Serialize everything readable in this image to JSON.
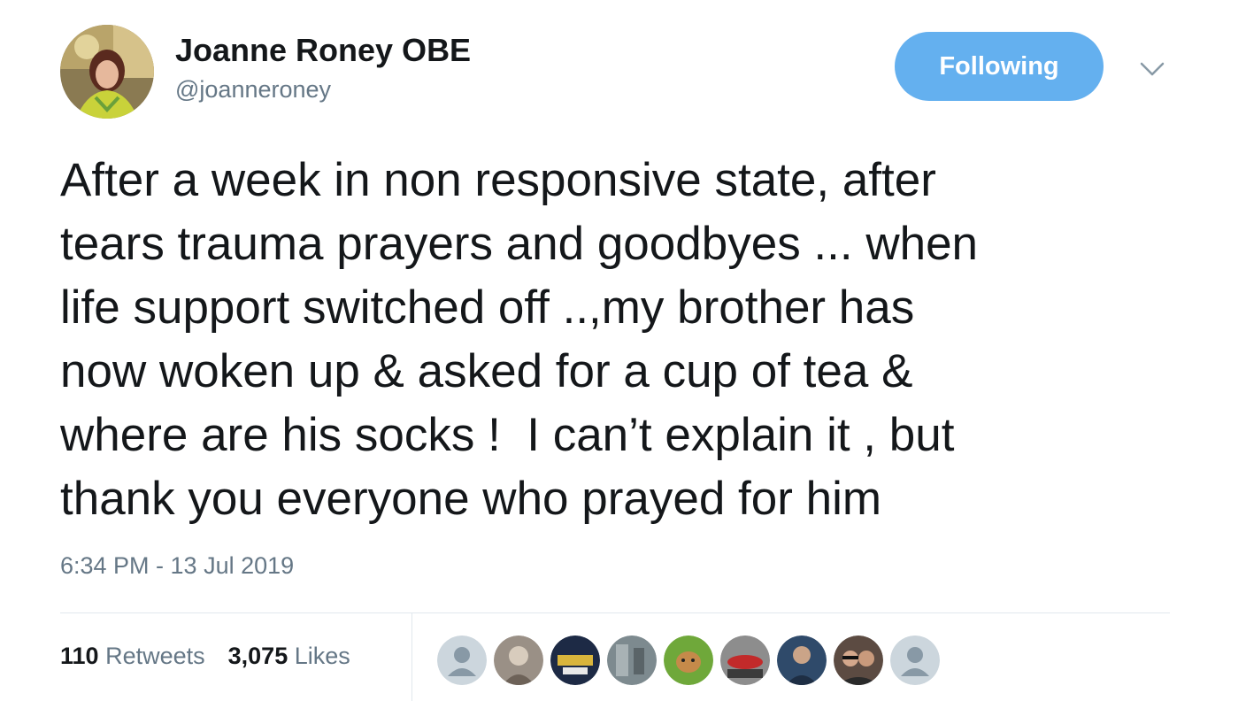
{
  "user": {
    "display_name": "Joanne Roney OBE",
    "handle": "@joanneroney",
    "avatar_icon": "profile-photo"
  },
  "follow_button": {
    "label": "Following",
    "color": "#64b0ef"
  },
  "menu": {
    "icon": "chevron-down-icon"
  },
  "tweet": {
    "lines": [
      "After a week in non responsive state, after",
      "tears trauma prayers and goodbyes ... when",
      "life support switched off ..,my brother has",
      "now woken up & asked for a cup of tea &",
      "where are his socks !  I can’t explain it , but",
      "thank you everyone who prayed for him"
    ],
    "timestamp": "6:34 PM - 13 Jul 2019"
  },
  "stats": {
    "retweets_count": "110",
    "retweets_label": "Retweets",
    "likes_count": "3,075",
    "likes_label": "Likes"
  },
  "likers": [
    "default-avatar-icon",
    "user-avatar",
    "user-avatar",
    "user-avatar",
    "user-avatar",
    "user-avatar",
    "user-avatar",
    "user-avatar",
    "default-avatar-icon"
  ],
  "colors": {
    "text": "#14171a",
    "secondary": "#657786",
    "divider": "#e1e8ed"
  }
}
